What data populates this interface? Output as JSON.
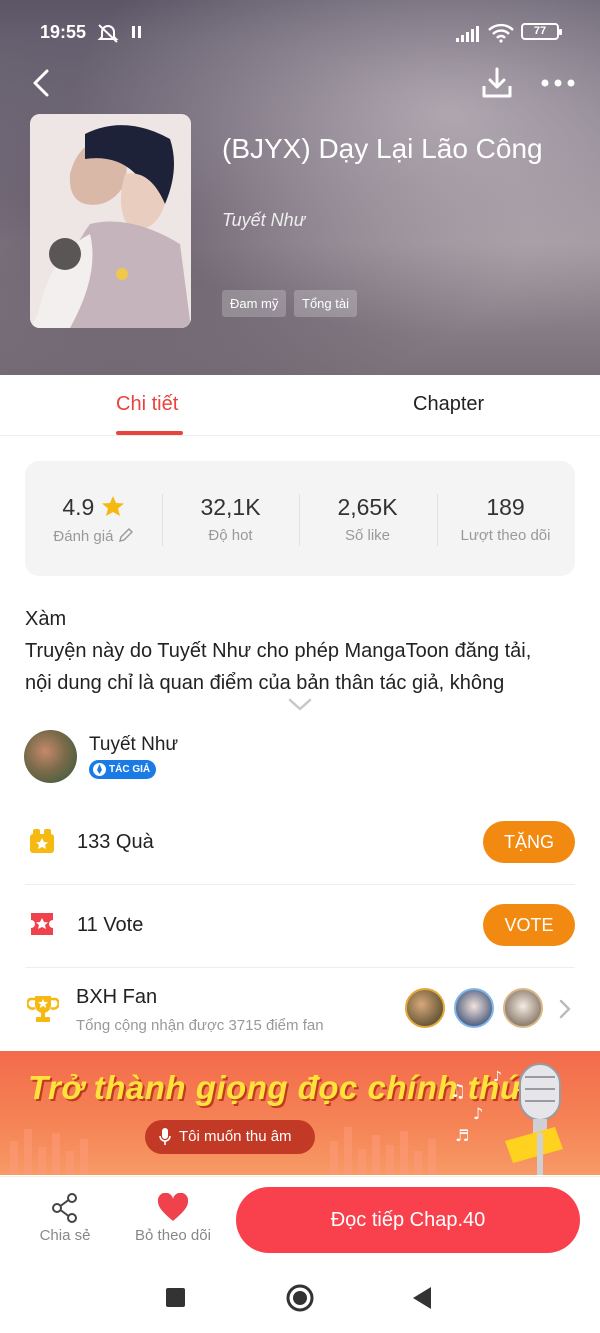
{
  "status_bar": {
    "time": "19:55",
    "battery": "77"
  },
  "book": {
    "title": "(BJYX) Dạy Lại Lão Công",
    "author": "Tuyết Như",
    "tags": [
      "Đam mỹ",
      "Tổng tài"
    ]
  },
  "tabs": [
    {
      "label": "Chi tiết",
      "active": true
    },
    {
      "label": "Chapter",
      "active": false
    }
  ],
  "stats": [
    {
      "value": "4.9",
      "label": "Đánh giá"
    },
    {
      "value": "32,1K",
      "label": "Độ hot"
    },
    {
      "value": "2,65K",
      "label": "Số like"
    },
    {
      "value": "189",
      "label": "Lượt theo dõi"
    }
  ],
  "description": {
    "line1": "Xàm",
    "line2": "Truyện này do Tuyết Như cho phép MangaToon đăng tải,",
    "line3": "nội dung chỉ là quan điểm của bản thân tác giả, không"
  },
  "author_card": {
    "name": "Tuyết Như",
    "badge": "TÁC GIẢ"
  },
  "gift": {
    "label": "133  Quà",
    "button": "TẶNG"
  },
  "vote": {
    "label": "11  Vote",
    "button": "VOTE"
  },
  "fan_rank": {
    "title": "BXH Fan",
    "subtitle": "Tổng cộng nhận được 3715 điểm fan"
  },
  "banner": {
    "title": "Trở thành giọng đọc chính thức!",
    "button": "Tôi muốn thu âm"
  },
  "bottom": {
    "share": "Chia sẻ",
    "unfollow": "Bỏ theo dõi",
    "read": "Đọc tiếp Chap.40"
  },
  "colors": {
    "accent": "#e8443d",
    "orange": "#f28a12",
    "read_button": "#f8414d"
  }
}
